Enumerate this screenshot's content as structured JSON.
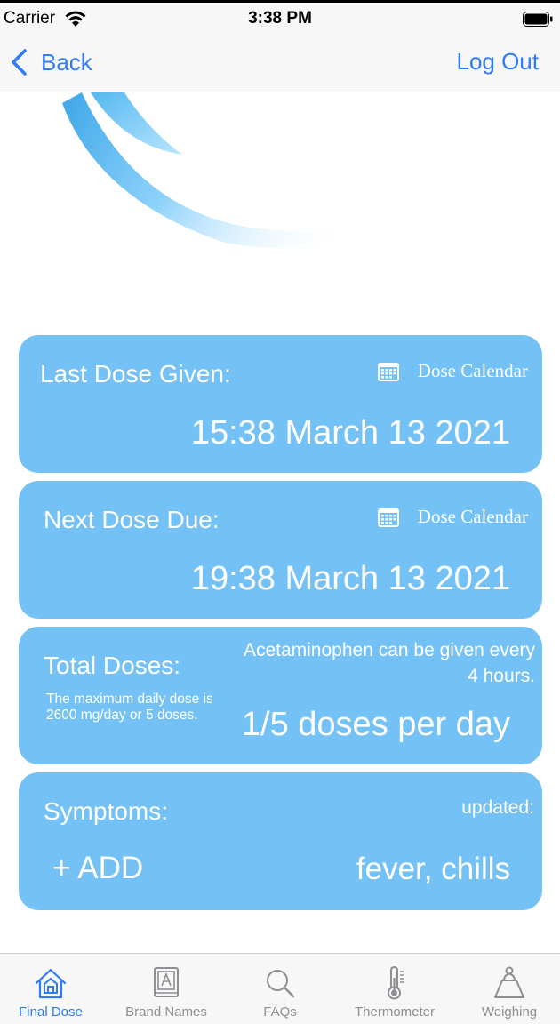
{
  "status_bar": {
    "carrier": "Carrier",
    "time": "3:38 PM"
  },
  "nav": {
    "back_label": "Back",
    "logout_label": "Log Out"
  },
  "colors": {
    "accent": "#2f7cf6",
    "card": "#74c2f5",
    "text_on_card": "#ffffff"
  },
  "last_dose": {
    "title": "Last Dose Given:",
    "calendar_label": "Dose Calendar",
    "value": "15:38 March 13 2021"
  },
  "next_dose": {
    "title": "Next Dose Due:",
    "calendar_label": "Dose Calendar",
    "value": "19:38 March 13 2021"
  },
  "total_doses": {
    "title": "Total Doses:",
    "note": "The maximum daily dose is 2600 mg/day or 5 doses.",
    "interval": "Acetaminophen can be given every 4 hours.",
    "value": "1/5 doses per day"
  },
  "symptoms": {
    "title": "Symptoms:",
    "updated": "updated:",
    "add_label": "+ ADD",
    "value": "fever, chills"
  },
  "tabs": [
    {
      "label": "Final Dose",
      "icon": "home-icon",
      "active": true
    },
    {
      "label": "Brand Names",
      "icon": "book-icon",
      "active": false
    },
    {
      "label": "FAQs",
      "icon": "search-icon",
      "active": false
    },
    {
      "label": "Thermometer",
      "icon": "thermometer-icon",
      "active": false
    },
    {
      "label": "Weighing",
      "icon": "scale-icon",
      "active": false
    }
  ]
}
